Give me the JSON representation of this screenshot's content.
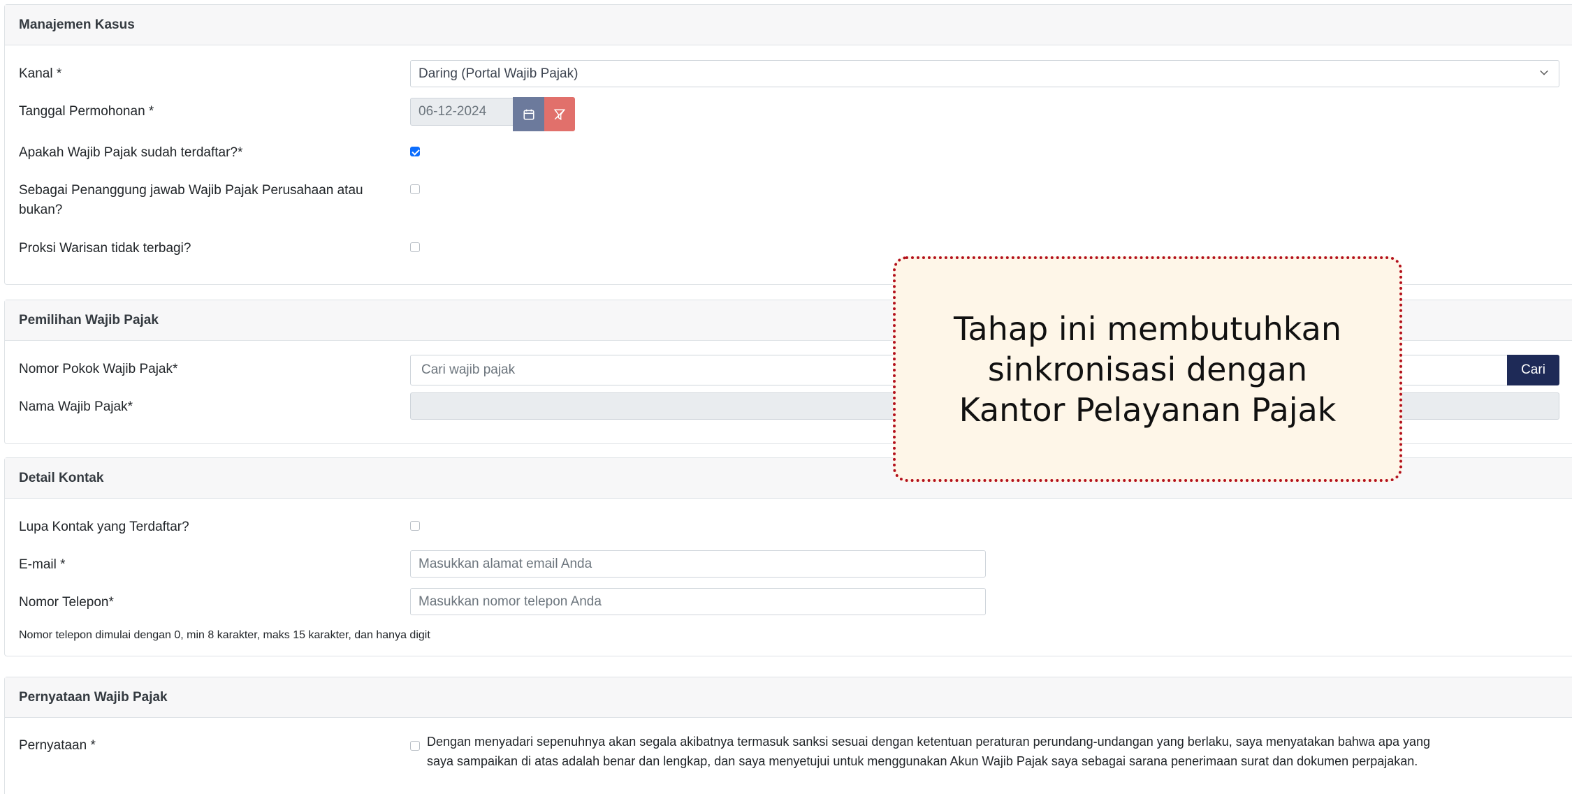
{
  "case_management": {
    "title": "Manajemen Kasus",
    "channel_label": "Kanal *",
    "channel_value": "Daring (Portal Wajib Pajak)",
    "date_label": "Tanggal Permohonan *",
    "date_value": "06-12-2024",
    "registered_label": "Apakah Wajib Pajak sudah terdaftar?*",
    "registered_checked": true,
    "responsible_label_1": "Sebagai Penanggung jawab Wajib Pajak Perusahaan atau",
    "responsible_label_2": "bukan?",
    "responsible_checked": false,
    "inheritance_label": "Proksi Warisan tidak terbagi?",
    "inheritance_checked": false
  },
  "taxpayer_selection": {
    "title": "Pemilihan Wajib Pajak",
    "npwp_label": "Nomor Pokok Wajib Pajak*",
    "search_placeholder": "Cari wajib pajak",
    "search_button": "Cari",
    "name_label": "Nama Wajib Pajak*",
    "name_value": ""
  },
  "contact_details": {
    "title": "Detail Kontak",
    "forgot_label": "Lupa Kontak yang Terdaftar?",
    "forgot_checked": false,
    "email_label": "E-mail *",
    "email_placeholder": "Masukkan alamat email Anda",
    "phone_label": "Nomor Telepon*",
    "phone_placeholder": "Masukkan nomor telepon Anda",
    "phone_hint": "Nomor telepon dimulai dengan 0, min 8 karakter, maks 15 karakter, dan hanya digit"
  },
  "statement": {
    "title": "Pernyataan Wajib Pajak",
    "label": "Pernyataan *",
    "checked": false,
    "text_line_1": "Dengan menyadari sepenuhnya akan segala akibatnya termasuk sanksi sesuai dengan ketentuan peraturan perundang-undangan yang berlaku, saya menyatakan bahwa apa yang",
    "text_line_2": "saya sampaikan di atas adalah benar dan lengkap, dan saya menyetujui untuk menggunakan Akun Wajib Pajak saya sebagai sarana penerimaan surat dan dokumen perpajakan."
  },
  "callout": {
    "line_1": "Tahap ini membutuhkan",
    "line_2": "sinkronisasi dengan",
    "line_3": "Kantor Pelayanan Pajak"
  },
  "colors": {
    "calendar_button": "#6c7a9c",
    "clear_button": "#e1706b",
    "search_button": "#1e2a57",
    "callout_border": "#b3101c",
    "callout_bg": "#fef6e8"
  },
  "icons": {
    "calendar": "calendar-icon",
    "clear_filter": "filter-clear-icon",
    "dropdown": "chevron-down-icon"
  }
}
